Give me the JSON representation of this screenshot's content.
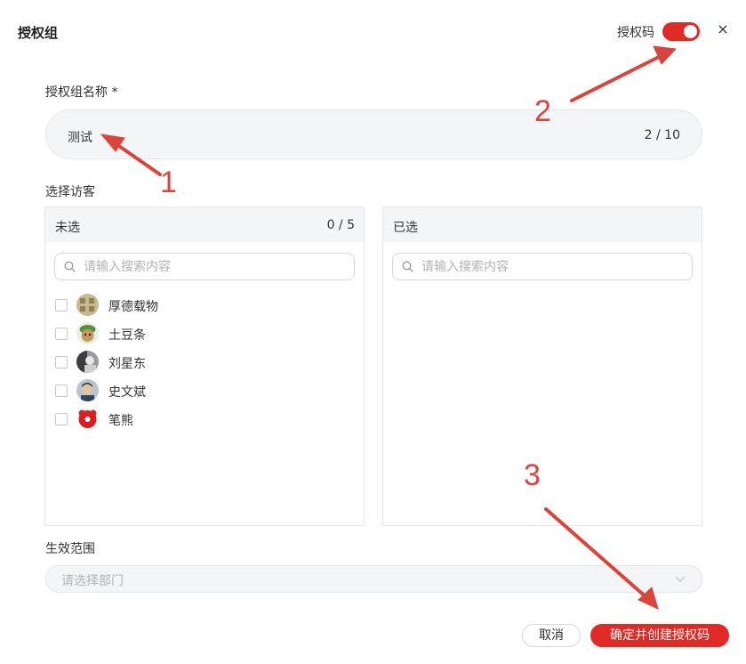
{
  "dialog": {
    "title": "授权组",
    "toggle_label": "授权码",
    "toggle_on": true,
    "close_glyph": "×"
  },
  "name_field": {
    "label": "授权组名称 *",
    "value": "测试",
    "counter": "2 / 10"
  },
  "visitors": {
    "label": "选择访客",
    "unselected": {
      "title": "未选",
      "count": "0 / 5",
      "search_placeholder": "请输入搜索内容",
      "items": [
        {
          "name": "厚德载物",
          "avatar": "calligraphy-avatar"
        },
        {
          "name": "土豆条",
          "avatar": "cartoon-cat-avatar"
        },
        {
          "name": "刘星东",
          "avatar": "photo-avatar"
        },
        {
          "name": "史文斌",
          "avatar": "photo-avatar"
        },
        {
          "name": "笔熊",
          "avatar": "red-bear-logo-avatar"
        }
      ]
    },
    "selected": {
      "title": "已选",
      "search_placeholder": "请输入搜索内容"
    }
  },
  "scope": {
    "label": "生效范围",
    "placeholder": "请选择部门"
  },
  "footer": {
    "cancel_label": "取消",
    "confirm_label": "确定并创建授权码"
  },
  "annotations": {
    "marker_1": "1",
    "marker_2": "2",
    "marker_3": "3",
    "arrow_color": "#d9443c"
  },
  "colors": {
    "accent": "#e02a26",
    "panel_bg": "#f4f5f7"
  }
}
